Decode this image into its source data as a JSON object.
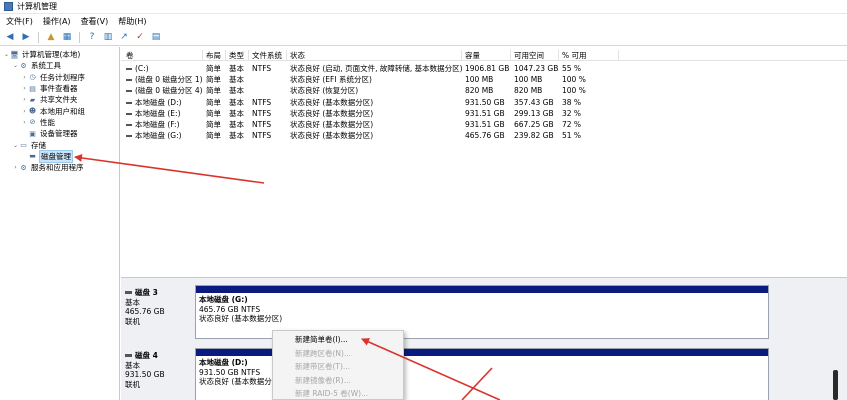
{
  "window": {
    "title": "计算机管理"
  },
  "menu": [
    "文件(F)",
    "操作(A)",
    "查看(V)",
    "帮助(H)"
  ],
  "tree": [
    {
      "label": "计算机管理(本地)",
      "level": 0,
      "twisty": "⌄",
      "icon": "computer-icon",
      "glyph": "🖥"
    },
    {
      "label": "系统工具",
      "level": 1,
      "twisty": "⌄",
      "icon": "tools-icon",
      "glyph": "⚙"
    },
    {
      "label": "任务计划程序",
      "level": 2,
      "twisty": "›",
      "icon": "clock-icon",
      "glyph": "◷"
    },
    {
      "label": "事件查看器",
      "level": 2,
      "twisty": "›",
      "icon": "event-viewer-icon",
      "glyph": "▤"
    },
    {
      "label": "共享文件夹",
      "level": 2,
      "twisty": "›",
      "icon": "shared-folder-icon",
      "glyph": "▰"
    },
    {
      "label": "本地用户和组",
      "level": 2,
      "twisty": "›",
      "icon": "users-icon",
      "glyph": "☻"
    },
    {
      "label": "性能",
      "level": 2,
      "twisty": "›",
      "icon": "performance-icon",
      "glyph": "⊘"
    },
    {
      "label": "设备管理器",
      "level": 2,
      "twisty": "",
      "icon": "device-manager-icon",
      "glyph": "▣"
    },
    {
      "label": "存储",
      "level": 1,
      "twisty": "⌄",
      "icon": "storage-icon",
      "glyph": "▭"
    },
    {
      "label": "磁盘管理",
      "level": 2,
      "twisty": "",
      "icon": "disk-management-icon",
      "glyph": "▬",
      "selected": true
    },
    {
      "label": "服务和应用程序",
      "level": 1,
      "twisty": "›",
      "icon": "services-icon",
      "glyph": "⚙"
    }
  ],
  "volumes": {
    "headers": [
      "卷",
      "布局",
      "类型",
      "文件系统",
      "状态",
      "容量",
      "可用空间",
      "% 可用"
    ],
    "rows": [
      [
        "(C:)",
        "简单",
        "基本",
        "NTFS",
        "状态良好 (启动, 页面文件, 故障转储, 基本数据分区)",
        "1906.81 GB",
        "1047.23 GB",
        "55 %"
      ],
      [
        "(磁盘 0 磁盘分区 1)",
        "简单",
        "基本",
        "",
        "状态良好 (EFI 系统分区)",
        "100 MB",
        "100 MB",
        "100 %"
      ],
      [
        "(磁盘 0 磁盘分区 4)",
        "简单",
        "基本",
        "",
        "状态良好 (恢复分区)",
        "820 MB",
        "820 MB",
        "100 %"
      ],
      [
        "本地磁盘 (D:)",
        "简单",
        "基本",
        "NTFS",
        "状态良好 (基本数据分区)",
        "931.50 GB",
        "357.43 GB",
        "38 %"
      ],
      [
        "本地磁盘 (E:)",
        "简单",
        "基本",
        "NTFS",
        "状态良好 (基本数据分区)",
        "931.51 GB",
        "299.13 GB",
        "32 %"
      ],
      [
        "本地磁盘 (F:)",
        "简单",
        "基本",
        "NTFS",
        "状态良好 (基本数据分区)",
        "931.51 GB",
        "667.25 GB",
        "72 %"
      ],
      [
        "本地磁盘 (G:)",
        "简单",
        "基本",
        "NTFS",
        "状态良好 (基本数据分区)",
        "465.76 GB",
        "239.82 GB",
        "51 %"
      ]
    ]
  },
  "disks": [
    {
      "name": "磁盘 3",
      "type": "基本",
      "size": "465.76 GB",
      "status": "联机",
      "partition": {
        "name": "本地磁盘 (G:)",
        "size": "465.76 GB NTFS",
        "status": "状态良好 (基本数据分区)"
      }
    },
    {
      "name": "磁盘 4",
      "type": "基本",
      "size": "931.50 GB",
      "status": "联机",
      "partition": {
        "name": "本地磁盘 (D:)",
        "size": "931.50 GB NTFS",
        "status": "状态良好 (基本数据分区)"
      }
    }
  ],
  "context_menu": [
    {
      "label": "新建简单卷(I)...",
      "enabled": true
    },
    {
      "label": "新建跨区卷(N)...",
      "enabled": false
    },
    {
      "label": "新建带区卷(T)...",
      "enabled": false
    },
    {
      "label": "新建镜像卷(R)...",
      "enabled": false
    },
    {
      "label": "新建 RAID-5 卷(W)...",
      "enabled": false
    }
  ],
  "colors": {
    "annotation_arrow": "#d9342b",
    "partition_bar": "#0a1a7e",
    "selection": "#cce4f7"
  }
}
